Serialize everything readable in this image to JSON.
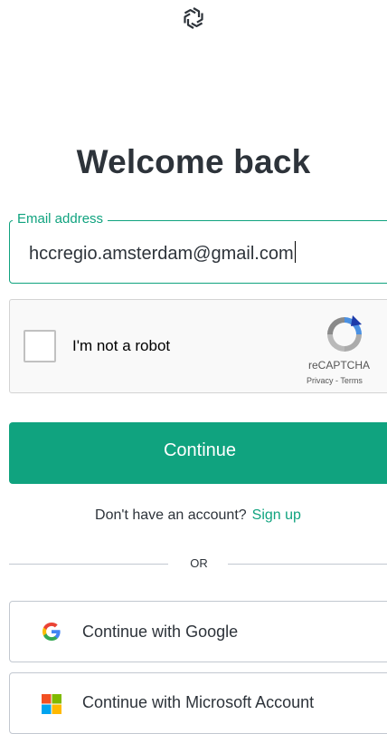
{
  "logo_icon": "openai-logo-icon",
  "title": "Welcome back",
  "email": {
    "label": "Email address",
    "value": "hccregio.amsterdam@gmail.com"
  },
  "recaptcha": {
    "checkbox_label": "I'm not a robot",
    "brand": "reCAPTCHA",
    "links": "Privacy - Terms"
  },
  "continue_label": "Continue",
  "signup": {
    "prompt": "Don't have an account?",
    "link": "Sign up"
  },
  "divider_text": "OR",
  "social": {
    "google": "Continue with Google",
    "microsoft": "Continue with Microsoft Account"
  },
  "colors": {
    "accent": "#10a37f",
    "text": "#2d333a",
    "border": "#c2c8d0"
  }
}
